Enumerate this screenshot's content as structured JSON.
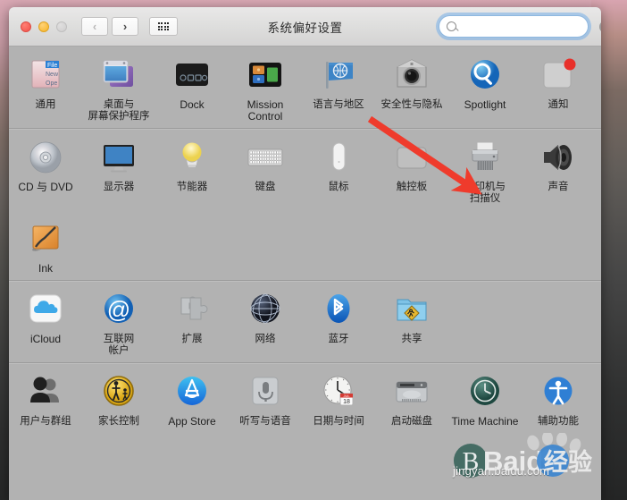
{
  "window": {
    "title": "系统偏好设置",
    "traffic_lights": [
      "close",
      "minimize",
      "zoom"
    ],
    "nav": {
      "back_label": "‹",
      "forward_label": "›",
      "grid_label": "show-all"
    },
    "search": {
      "value": "",
      "placeholder": "",
      "clear_label": "✕"
    }
  },
  "sections": [
    {
      "name": "personal",
      "panes": [
        {
          "icon": "general-icon",
          "label": "通用",
          "latin": false
        },
        {
          "icon": "desktop-saver-icon",
          "label": "桌面与\n屏幕保护程序",
          "latin": false
        },
        {
          "icon": "dock-icon",
          "label": "Dock",
          "latin": true
        },
        {
          "icon": "mission-control-icon",
          "label": "Mission\nControl",
          "latin": true
        },
        {
          "icon": "language-region-icon",
          "label": "语言与地区",
          "latin": false
        },
        {
          "icon": "security-privacy-icon",
          "label": "安全性与隐私",
          "latin": false
        },
        {
          "icon": "spotlight-icon",
          "label": "Spotlight",
          "latin": true
        },
        {
          "icon": "notifications-icon",
          "label": "通知",
          "latin": false
        }
      ]
    },
    {
      "name": "hardware",
      "panes": [
        {
          "icon": "cd-dvd-icon",
          "label": "CD 与 DVD",
          "latin": true
        },
        {
          "icon": "displays-icon",
          "label": "显示器",
          "latin": false
        },
        {
          "icon": "energy-saver-icon",
          "label": "节能器",
          "latin": false
        },
        {
          "icon": "keyboard-icon",
          "label": "键盘",
          "latin": false
        },
        {
          "icon": "mouse-icon",
          "label": "鼠标",
          "latin": false
        },
        {
          "icon": "trackpad-icon",
          "label": "触控板",
          "latin": false
        },
        {
          "icon": "printers-scanners-icon",
          "label": "打印机与\n扫描仪",
          "latin": false
        },
        {
          "icon": "sound-icon",
          "label": "声音",
          "latin": false
        },
        {
          "icon": "ink-icon",
          "label": "Ink",
          "latin": true
        }
      ]
    },
    {
      "name": "internet-wireless",
      "panes": [
        {
          "icon": "icloud-icon",
          "label": "iCloud",
          "latin": true
        },
        {
          "icon": "internet-accounts-icon",
          "label": "互联网\n帐户",
          "latin": false
        },
        {
          "icon": "extensions-icon",
          "label": "扩展",
          "latin": false
        },
        {
          "icon": "network-icon",
          "label": "网络",
          "latin": false
        },
        {
          "icon": "bluetooth-icon",
          "label": "蓝牙",
          "latin": false
        },
        {
          "icon": "sharing-icon",
          "label": "共享",
          "latin": false
        }
      ]
    },
    {
      "name": "system",
      "panes": [
        {
          "icon": "users-groups-icon",
          "label": "用户与群组",
          "latin": false
        },
        {
          "icon": "parental-controls-icon",
          "label": "家长控制",
          "latin": false
        },
        {
          "icon": "app-store-icon",
          "label": "App Store",
          "latin": true
        },
        {
          "icon": "dictation-speech-icon",
          "label": "听写与语音",
          "latin": false
        },
        {
          "icon": "date-time-icon",
          "label": "日期与时间",
          "latin": false
        },
        {
          "icon": "startup-disk-icon",
          "label": "启动磁盘",
          "latin": false
        },
        {
          "icon": "time-machine-icon",
          "label": "Time Machine",
          "latin": true
        },
        {
          "icon": "accessibility-icon",
          "label": "辅助功能",
          "latin": false
        }
      ]
    }
  ],
  "annotation": {
    "arrow_color": "#ef3b2c",
    "points_to": "打印机与扫描仪"
  },
  "watermark": {
    "brand": "Baidu",
    "suffix": "经验",
    "url": "jingyan.baidu.com"
  }
}
